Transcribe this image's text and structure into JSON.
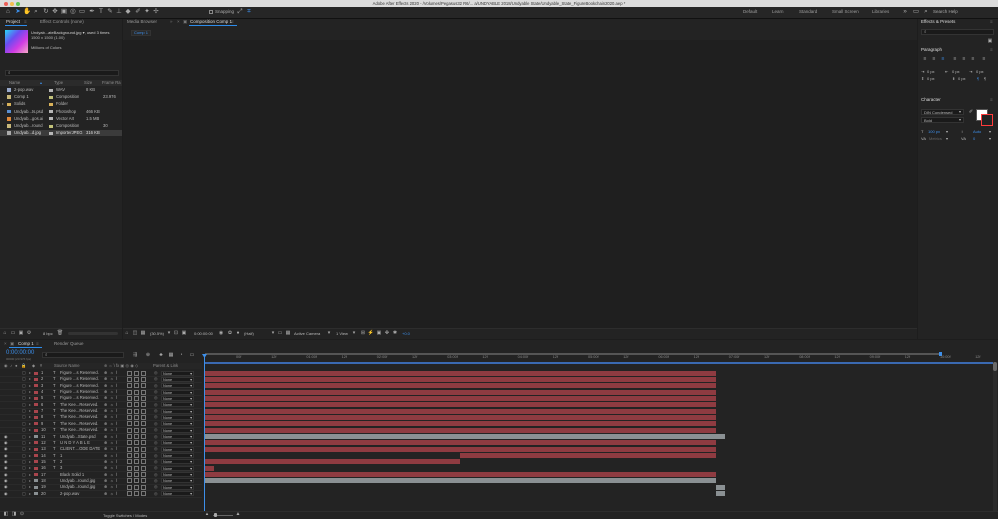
{
  "app": {
    "window_title": "Adobe After Effects 2020 - /Volumes/Pegasus32 R6/... a/UNDYABLE 2018/Undyable State/Undyable_State_FigureBookchain2020.aep *"
  },
  "colors": {
    "accent": "#2d8ceb",
    "red_layer": "#a8454d",
    "red_bar": "#8e3b41",
    "gray_bar": "#8a9093",
    "timecode": "#3d8fea",
    "work_area": "#3a69b1"
  },
  "toolbar": {
    "snapping_label": "Snapping",
    "workspaces": [
      "Default",
      "Learn",
      "Standard",
      "Small Screen",
      "Libraries"
    ],
    "search_placeholder": "Search Help"
  },
  "project_panel": {
    "tab_project": "Project",
    "tab_effect_controls": "Effect Controls (none)",
    "selected_name": "Undyab...ateBackground.jpg",
    "used_times": ", used 3 times",
    "dimensions": "1500 x 1500 (1.00)",
    "colors": "Millions of Colors",
    "search_placeholder": "",
    "columns": [
      "Name",
      "Type",
      "Size",
      "Frame Ra"
    ],
    "items": [
      {
        "name": "2-pop.wav",
        "type": "WAV",
        "size": "8 KB",
        "fps": "",
        "chip": "#b7b7b7",
        "icon": "audio"
      },
      {
        "name": "Comp 1",
        "type": "Composition",
        "size": "",
        "fps": "23.976",
        "chip": "#c2c27a",
        "icon": "comp"
      },
      {
        "name": "Solids",
        "type": "Folder",
        "size": "",
        "fps": "",
        "chip": "#d9b25a",
        "icon": "folder"
      },
      {
        "name": "Undyab...ts.psd",
        "type": "Photoshop",
        "size": "466 KB",
        "fps": "",
        "chip": "#b7b7b7",
        "icon": "psd"
      },
      {
        "name": "Undyab...gos.ai",
        "type": "Vector Art",
        "size": "1.5 MB",
        "fps": "",
        "chip": "#b7b7b7",
        "icon": "ai"
      },
      {
        "name": "Undyab...round",
        "type": "Composition",
        "size": "",
        "fps": "30",
        "chip": "#c2c27a",
        "icon": "comp"
      },
      {
        "name": "Undyab...d.jpg",
        "type": "ImporterJPEG",
        "size": "316 KB",
        "fps": "",
        "chip": "#b7b7b7",
        "icon": "jpg"
      }
    ],
    "footer_bpc": "8 bpc"
  },
  "media_browser": {
    "tab_label": "Media Browser"
  },
  "composition_panel": {
    "tab_label": "Composition Comp 1",
    "sub_tab": "Comp 1",
    "zoom": "(30.5%)",
    "timecode": "0:00:00:00",
    "resolution": "(Half)",
    "camera": "Active Camera",
    "views": "1 View",
    "exposure": "+0.0"
  },
  "effects_panel": {
    "title": "Effects & Presets",
    "search_placeholder": ""
  },
  "paragraph_panel": {
    "title": "Paragraph",
    "indent_values": [
      "0 px",
      "0 px",
      "0 px"
    ],
    "space_values": [
      "0 px",
      "0 px"
    ]
  },
  "character_panel": {
    "title": "Character",
    "font": "DIN Condensed",
    "style": "Bold",
    "size": "100 px",
    "leading": "Auto",
    "kerning": "Metrics",
    "tracking": "0"
  },
  "timeline": {
    "tab_label": "Comp 1",
    "render_queue": "Render Queue",
    "timecode": "0:00:00:00",
    "frame_info": "00000 (23.976 fps)",
    "search_placeholder": "",
    "col_source": "Source Name",
    "col_parent": "Parent & Link",
    "toggle_label": "Toggle Switches / Modes",
    "ruler_labels": [
      "00f",
      "12f",
      "01:00f",
      "12f",
      "02:00f",
      "12f",
      "03:00f",
      "12f",
      "04:00f",
      "12f",
      "05:00f",
      "12f",
      "06:00f",
      "12f",
      "07:00f",
      "12f",
      "08:00f",
      "12f",
      "09:00f",
      "12f",
      "10:00f",
      "12f",
      "11:00f"
    ],
    "layers": [
      {
        "num": "1",
        "type": "T",
        "name": "Figure ...s Reserved.",
        "parent": "None",
        "chip": "#a8454d",
        "bar_start": 0.0,
        "bar_end": 0.58,
        "bar": "red"
      },
      {
        "num": "2",
        "type": "T",
        "name": "Figure ...s Reserved.",
        "parent": "None",
        "chip": "#a8454d",
        "bar_start": 0.0,
        "bar_end": 0.58,
        "bar": "red"
      },
      {
        "num": "3",
        "type": "T",
        "name": "Figure ...s Reserved.",
        "parent": "None",
        "chip": "#a8454d",
        "bar_start": 0.0,
        "bar_end": 0.58,
        "bar": "red"
      },
      {
        "num": "4",
        "type": "T",
        "name": "Figure ...s Reserved.",
        "parent": "None",
        "chip": "#a8454d",
        "bar_start": 0.0,
        "bar_end": 0.58,
        "bar": "red"
      },
      {
        "num": "5",
        "type": "T",
        "name": "Figure ...s Reserved.",
        "parent": "None",
        "chip": "#a8454d",
        "bar_start": 0.0,
        "bar_end": 0.58,
        "bar": "red"
      },
      {
        "num": "6",
        "type": "T",
        "name": "The Kee...Reserved.",
        "parent": "None",
        "chip": "#a8454d",
        "bar_start": 0.0,
        "bar_end": 0.58,
        "bar": "red"
      },
      {
        "num": "7",
        "type": "T",
        "name": "The Kee...Reserved.",
        "parent": "None",
        "chip": "#a8454d",
        "bar_start": 0.0,
        "bar_end": 0.58,
        "bar": "red"
      },
      {
        "num": "8",
        "type": "T",
        "name": "The Kee...Reserved.",
        "parent": "None",
        "chip": "#a8454d",
        "bar_start": 0.0,
        "bar_end": 0.58,
        "bar": "red"
      },
      {
        "num": "9",
        "type": "T",
        "name": "The Kee...Reserved.",
        "parent": "None",
        "chip": "#a8454d",
        "bar_start": 0.0,
        "bar_end": 0.58,
        "bar": "red"
      },
      {
        "num": "10",
        "type": "T",
        "name": "The Kee...Reserved.",
        "parent": "None",
        "chip": "#a8454d",
        "bar_start": 0.0,
        "bar_end": 0.58,
        "bar": "red"
      },
      {
        "num": "11",
        "type": "T",
        "name": "Undyab...State.psd",
        "parent": "None",
        "chip": "#8a9093",
        "bar_start": 0.0,
        "bar_end": 0.59,
        "bar": "gray"
      },
      {
        "num": "12",
        "type": "T",
        "name": "U N D Y A B L E",
        "parent": "None",
        "chip": "#a8454d",
        "bar_start": 0.0,
        "bar_end": 0.58,
        "bar": "red"
      },
      {
        "num": "13",
        "type": "T",
        "name": "CLIENT....ODE DATE",
        "parent": "None",
        "chip": "#a8454d",
        "bar_start": 0.0,
        "bar_end": 0.58,
        "bar": "red"
      },
      {
        "num": "14",
        "type": "T",
        "name": "1",
        "parent": "None",
        "chip": "#a8454d",
        "bar_start": 0.29,
        "bar_end": 0.58,
        "bar": "red"
      },
      {
        "num": "15",
        "type": "T",
        "name": "2",
        "parent": "None",
        "chip": "#a8454d",
        "bar_start": 0.0,
        "bar_end": 0.29,
        "bar": "red"
      },
      {
        "num": "16",
        "type": "T",
        "name": "3",
        "parent": "None",
        "chip": "#a8454d",
        "bar_start": 0.0,
        "bar_end": 0.01,
        "bar": "red"
      },
      {
        "num": "17",
        "type": "",
        "name": "Black Solid 1",
        "parent": "None",
        "chip": "#a8454d",
        "bar_start": 0.0,
        "bar_end": 0.58,
        "bar": "red"
      },
      {
        "num": "18",
        "type": "",
        "name": "Undyab...round.jpg",
        "parent": "None",
        "chip": "#8a9093",
        "bar_start": 0.0,
        "bar_end": 0.58,
        "bar": "gray"
      },
      {
        "num": "19",
        "type": "",
        "name": "Undyab...round.jpg",
        "parent": "None",
        "chip": "#8a9093",
        "bar_start": 0.58,
        "bar_end": 0.59,
        "bar": "gray"
      },
      {
        "num": "20",
        "type": "",
        "name": "2-pop.wav",
        "parent": "None",
        "chip": "#8a9093",
        "bar_start": 0.58,
        "bar_end": 0.59,
        "bar": "gray"
      }
    ]
  }
}
